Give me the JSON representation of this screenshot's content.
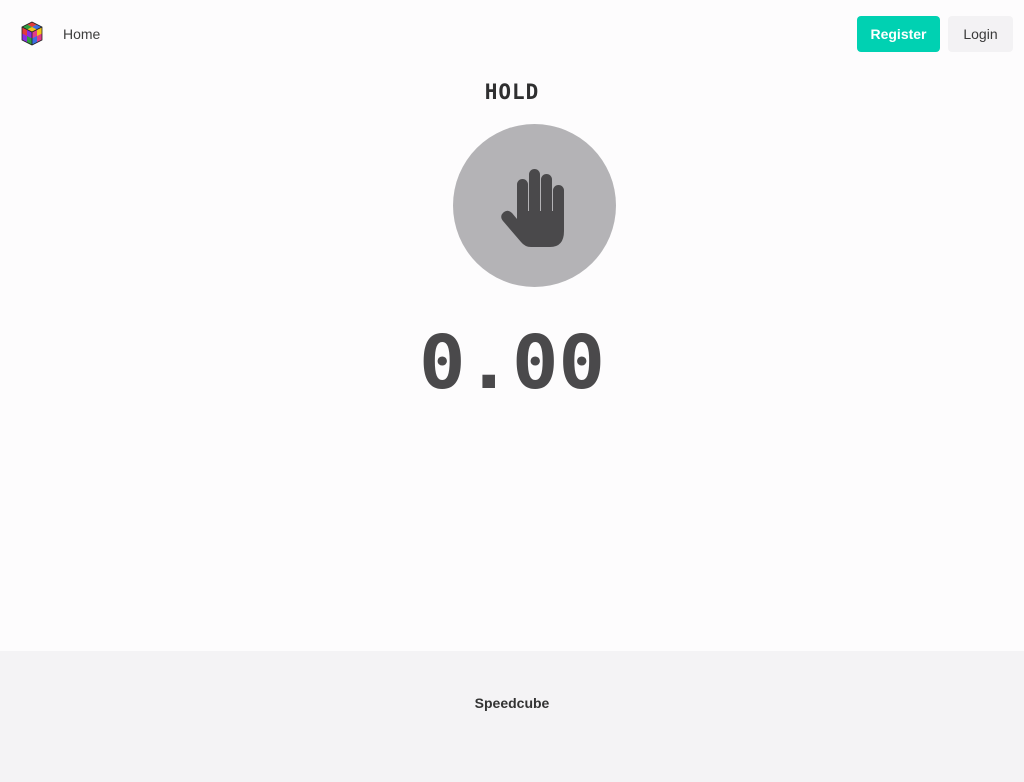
{
  "navbar": {
    "logo_icon": "rubiks-cube-icon",
    "home_label": "Home",
    "register_label": "Register",
    "login_label": "Login"
  },
  "main": {
    "status": "HOLD",
    "hand_icon": "hand-stop-icon",
    "timer_value": "0.00"
  },
  "footer": {
    "brand": "Speedcube"
  },
  "colors": {
    "accent": "#00d1b2",
    "circle": "#b4b3b6",
    "digits": "#4a494b",
    "footer_bg": "#f4f3f5"
  }
}
